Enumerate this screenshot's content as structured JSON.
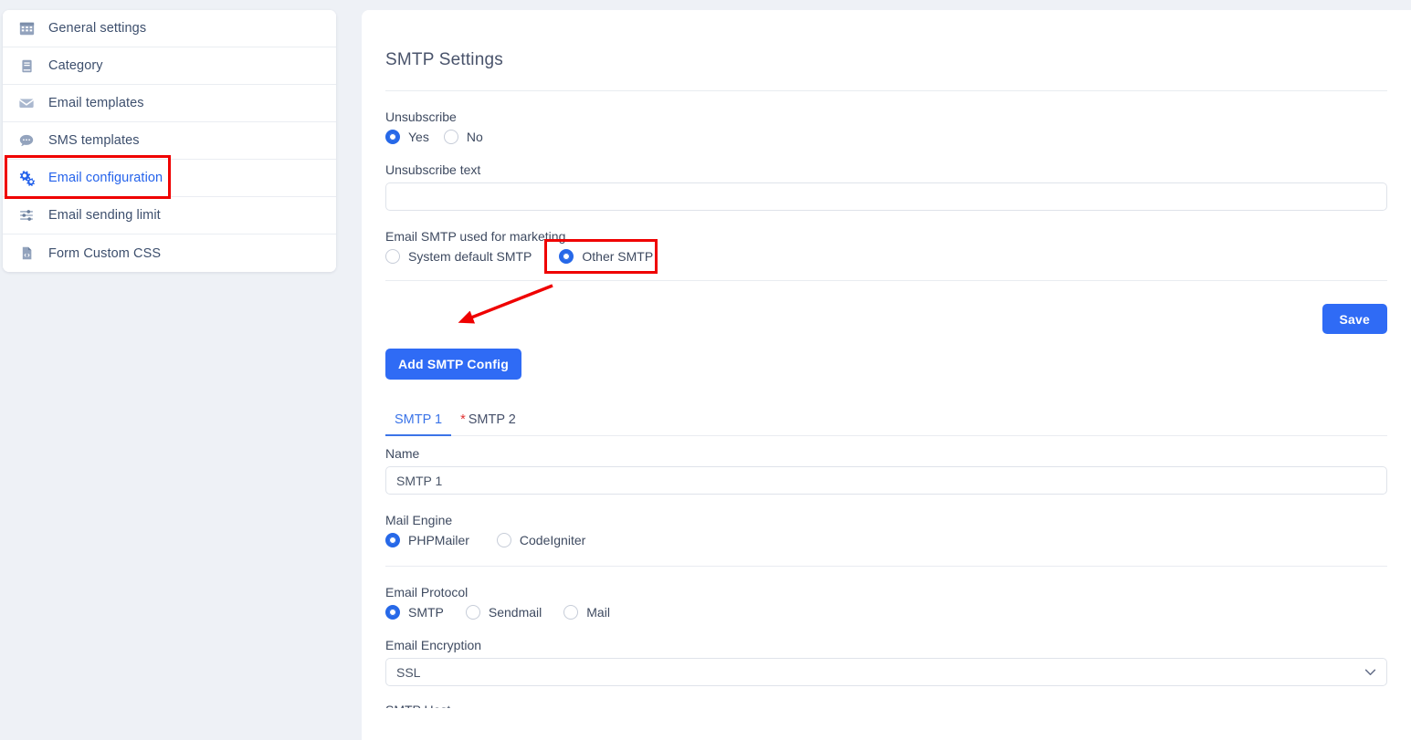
{
  "theme": {
    "page_bg": "#eef1f6",
    "card_bg": "#ffffff",
    "accent_blue": "#2f6bf5",
    "link_blue": "#2563eb",
    "annotation_red": "#ef0000",
    "label_text": "#3e4a60"
  },
  "sidebar": {
    "items": [
      {
        "label": "General settings",
        "icon": "grid-icon",
        "active": false
      },
      {
        "label": "Category",
        "icon": "book-icon",
        "active": false
      },
      {
        "label": "Email templates",
        "icon": "envelope-icon",
        "active": false
      },
      {
        "label": "SMS templates",
        "icon": "chat-bubble-icon",
        "active": false
      },
      {
        "label": "Email configuration",
        "icon": "gears-icon",
        "active": true
      },
      {
        "label": "Email sending limit",
        "icon": "sliders-icon",
        "active": false
      },
      {
        "label": "Form Custom CSS",
        "icon": "file-code-icon",
        "active": false
      }
    ]
  },
  "main": {
    "title": "SMTP Settings",
    "unsubscribe": {
      "label": "Unsubscribe",
      "options": [
        {
          "label": "Yes",
          "checked": true
        },
        {
          "label": "No",
          "checked": false
        }
      ]
    },
    "unsubscribe_text": {
      "label": "Unsubscribe text",
      "value": "",
      "placeholder": ""
    },
    "email_smtp_marketing": {
      "label": "Email SMTP used for marketing",
      "options": [
        {
          "label": "System default SMTP",
          "checked": false
        },
        {
          "label": "Other SMTP",
          "checked": true
        }
      ]
    },
    "save_label": "Save",
    "add_smtp_label": "Add SMTP Config",
    "tabs": [
      {
        "label": "SMTP 1",
        "required_marker": "",
        "active": true
      },
      {
        "label": "SMTP 2",
        "required_marker": "*",
        "active": false
      }
    ],
    "name_field": {
      "label": "Name",
      "value": "SMTP 1"
    },
    "mail_engine": {
      "label": "Mail Engine",
      "options": [
        {
          "label": "PHPMailer",
          "checked": true
        },
        {
          "label": "CodeIgniter",
          "checked": false
        }
      ]
    },
    "email_protocol": {
      "label": "Email Protocol",
      "options": [
        {
          "label": "SMTP",
          "checked": true
        },
        {
          "label": "Sendmail",
          "checked": false
        },
        {
          "label": "Mail",
          "checked": false
        }
      ]
    },
    "email_encryption": {
      "label": "Email Encryption",
      "value": "SSL",
      "chevron": "chevron-down-icon"
    },
    "next_field_partial": "SMTP Host"
  },
  "annotations": {
    "sidebar_highlight_target": "Email configuration",
    "radio_highlight_target": "Other SMTP",
    "arrow_points_to": "Add SMTP Config"
  }
}
